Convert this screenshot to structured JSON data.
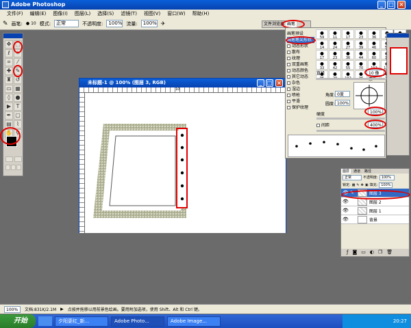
{
  "app": {
    "title": "Adobe Photoshop"
  },
  "menu": [
    "文件(F)",
    "编辑(E)",
    "图像(I)",
    "图层(L)",
    "选择(S)",
    "滤镜(T)",
    "视图(V)",
    "窗口(W)",
    "帮助(H)"
  ],
  "options": {
    "brush_label": "画笔:",
    "brush_size": "10",
    "mode_label": "模式:",
    "mode_value": "正常",
    "opacity_label": "不透明度:",
    "opacity_value": "100%",
    "flow_label": "流量:",
    "flow_value": "100%",
    "palette_well": "文件浏览器",
    "brush_tab": "画笔"
  },
  "document": {
    "title": "未标题-1 @ 100% (图层 3, RGB)",
    "ruler_mark": "10"
  },
  "brushes_panel": {
    "items": [
      "画笔预设",
      "画笔笔尖形状",
      "动态形状",
      "散布",
      "纹理",
      "双重画笔",
      "动态颜色",
      "其它动态",
      "杂色",
      "湿边",
      "喷枪",
      "平滑",
      "保护纹理"
    ],
    "selected": "画笔笔尖形状",
    "tip_numbers": [
      "59",
      "11",
      "17",
      "23",
      "36",
      "44",
      "60",
      "14",
      "24",
      "27",
      "39",
      "46",
      "59",
      "11",
      "17",
      "23",
      "36",
      "44",
      "60",
      "14",
      "26",
      "33",
      "42",
      "55",
      "70",
      "112",
      "134",
      "74",
      "95",
      "29",
      "192",
      "36",
      "36",
      "33",
      "63"
    ],
    "diameter_label": "直径",
    "diameter_value": "10 像素",
    "angle_label": "角度:",
    "angle_value": "0度",
    "roundness_label": "圆度:",
    "roundness_value": "100%",
    "hardness_label": "硬度",
    "hardness_value": "100%",
    "spacing_label": "间距",
    "spacing_value": "400%"
  },
  "layers_panel": {
    "tabs": [
      "图层",
      "通道",
      "路径"
    ],
    "blend_mode": "正常",
    "opacity_label": "不透明度:",
    "opacity_value": "100%",
    "lock_label": "锁定:",
    "fill_label": "填充:",
    "fill_value": "100%",
    "layers": [
      {
        "name": "图层 3",
        "selected": true
      },
      {
        "name": "图层 2",
        "selected": false
      },
      {
        "name": "图层 1",
        "selected": false
      },
      {
        "name": "背景",
        "selected": false
      }
    ]
  },
  "status": {
    "zoom": "100%",
    "doc_info": "文档:831K/2.1M",
    "hint": "点按并拖移以用前景色绘画。要用附加选项，使用 Shift、Alt 和 Ctrl 键。"
  },
  "taskbar": {
    "start": "开始",
    "tasks": [
      "夕阳更红_新...",
      "Adobe Photo...",
      "Adobe Image..."
    ],
    "clock": "20:27"
  },
  "colors": {
    "annotation": "#e00000",
    "selection": "#316ac5"
  }
}
